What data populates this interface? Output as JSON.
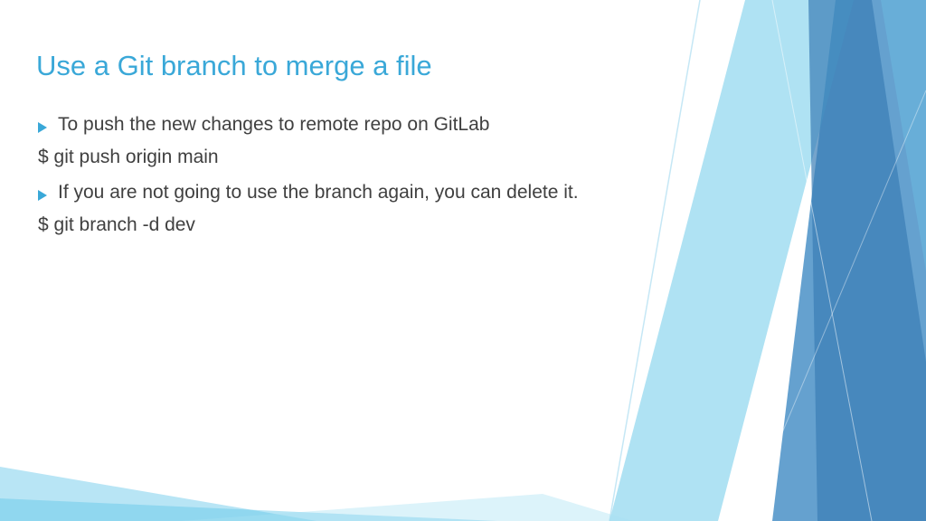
{
  "slide": {
    "title": "Use a Git branch to merge a file",
    "bullets": [
      {
        "text": "To push the new changes to remote repo on GitLab",
        "command": "$ git push origin main"
      },
      {
        "text": "If you are not going to use the branch again, you can delete it.",
        "command": "$ git branch -d dev"
      }
    ]
  }
}
